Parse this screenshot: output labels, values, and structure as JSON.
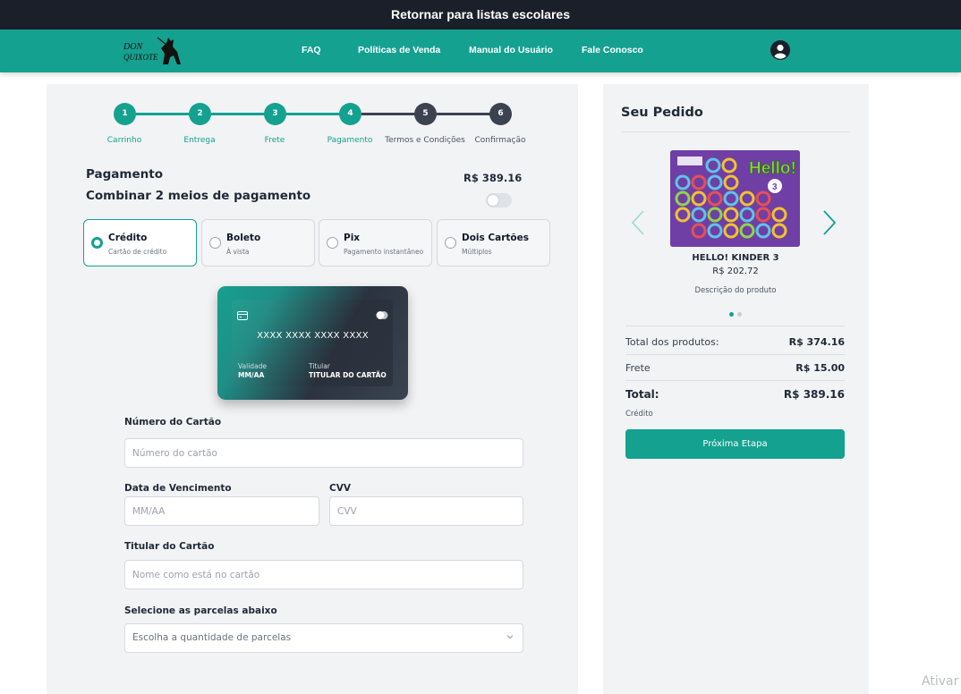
{
  "topbar": {
    "label": "Retornar para listas escolares"
  },
  "nav": {
    "logo_text": "DON QUIXOTE",
    "links": [
      "FAQ",
      "Políticas de Venda",
      "Manual do Usuário",
      "Fale Conosco"
    ],
    "user_icon": "user-circle-icon"
  },
  "steps": [
    {
      "num": "1",
      "label": "Carrinho",
      "done": true
    },
    {
      "num": "2",
      "label": "Entrega",
      "done": true
    },
    {
      "num": "3",
      "label": "Frete",
      "done": true
    },
    {
      "num": "4",
      "label": "Pagamento",
      "done": true
    },
    {
      "num": "5",
      "label": "Termos e Condições",
      "done": false
    },
    {
      "num": "6",
      "label": "Confirmação",
      "done": false
    }
  ],
  "payment": {
    "title": "Pagamento",
    "total": "R$ 389.16",
    "combine_label": "Combinar 2 meios de pagamento",
    "combine_enabled": false,
    "methods": [
      {
        "title": "Crédito",
        "subtitle": "Cartão de crédito",
        "selected": true
      },
      {
        "title": "Boleto",
        "subtitle": "À vista",
        "selected": false
      },
      {
        "title": "Pix",
        "subtitle": "Pagamento instantâneo",
        "selected": false
      },
      {
        "title": "Dois Cartões",
        "subtitle": "Múltiplos",
        "selected": false
      }
    ]
  },
  "card_preview": {
    "number": "XXXX XXXX XXXX XXXX",
    "validity_label": "Validade",
    "validity_value": "MM/AA",
    "holder_label": "Titular",
    "holder_value": "TITULAR DO CARTÃO"
  },
  "form": {
    "card_number_label": "Número do Cartão",
    "card_number_placeholder": "Número do cartão",
    "expiry_label": "Data de Vencimento",
    "expiry_placeholder": "MM/AA",
    "cvv_label": "CVV",
    "cvv_placeholder": "CVV",
    "holder_label": "Titular do Cartão",
    "holder_placeholder": "Nome como está no cartão",
    "installments_label": "Selecione as parcelas abaixo",
    "installments_value": "Escolha a quantidade de parcelas"
  },
  "order": {
    "title": "Seu Pedido",
    "product_name": "HELLO! KINDER 3",
    "product_price": "R$ 202.72",
    "product_description": "Descrição do produto",
    "cover_text": "Hello!",
    "cover_badge": "3",
    "products_label": "Total dos produtos:",
    "products_value": "R$ 374.16",
    "shipping_label": "Frete",
    "shipping_value": "R$ 15.00",
    "total_label": "Total:",
    "total_value": "R$ 389.16",
    "method_label": "Crédito",
    "next_button": "Próxima Etapa",
    "accent": "#14a190"
  },
  "watermark": "Ativar"
}
